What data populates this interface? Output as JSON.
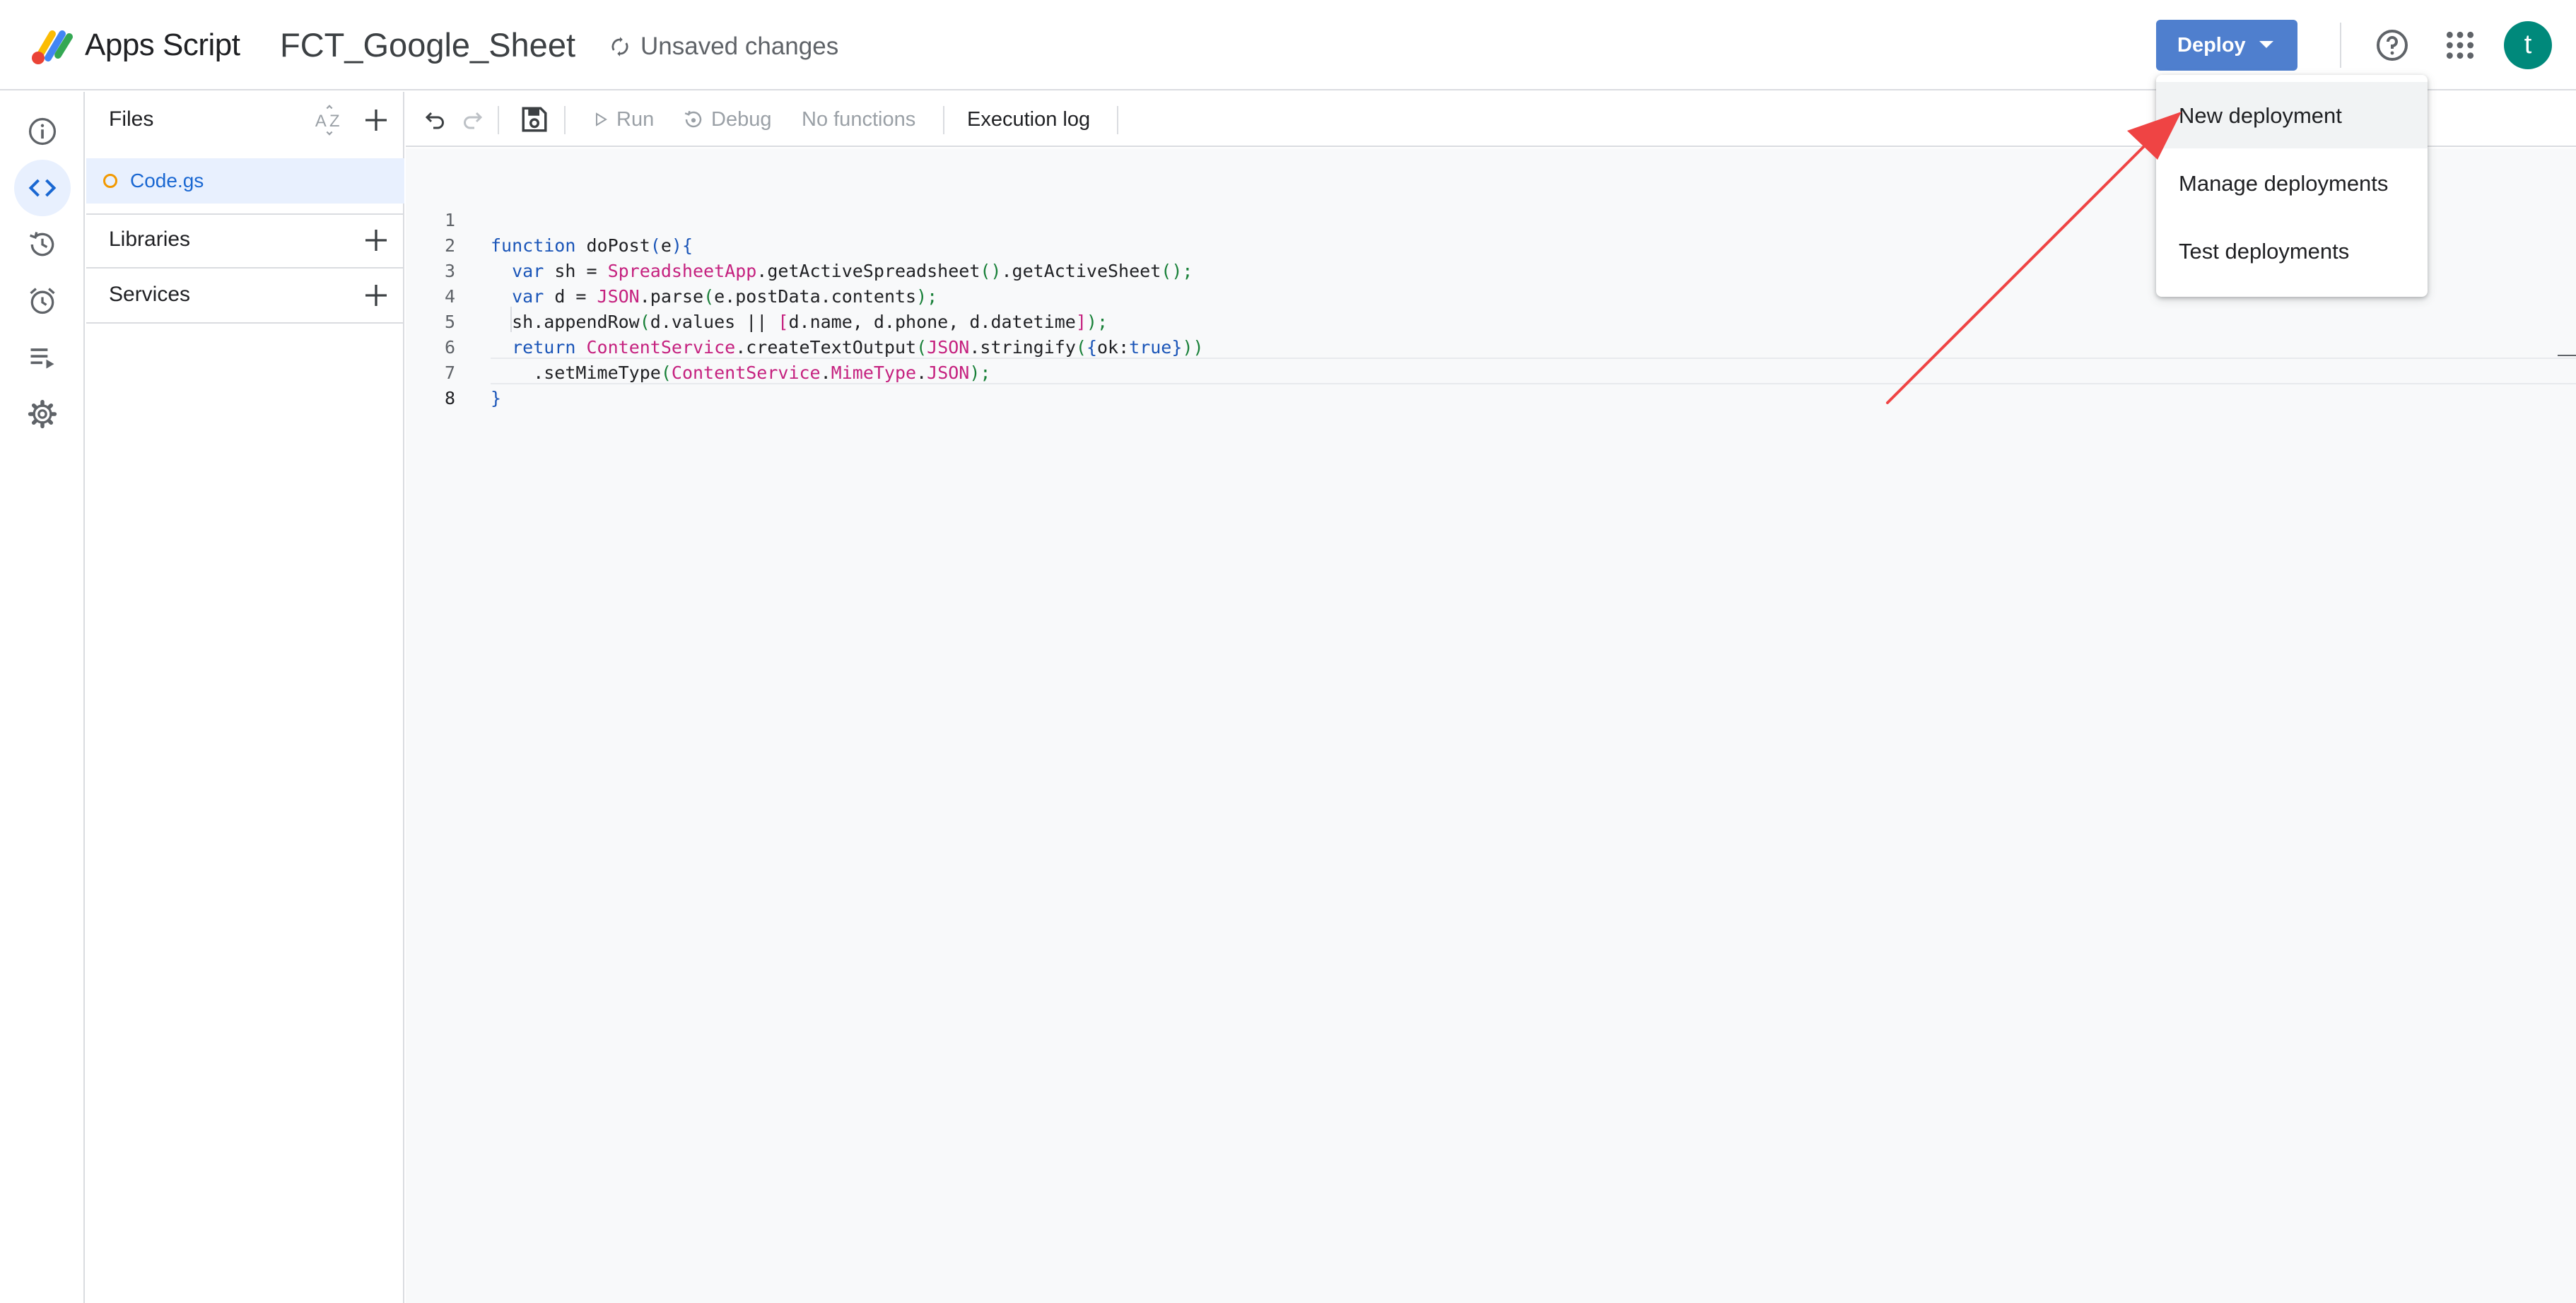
{
  "header": {
    "app_name": "Apps Script",
    "project_title": "FCT_Google_Sheet",
    "save_status": "Unsaved changes",
    "deploy_label": "Deploy",
    "avatar_initial": "t",
    "icons": [
      "apps-script-logo-icon",
      "sync-icon",
      "chevron-down-icon",
      "help-icon",
      "apps-grid-icon"
    ]
  },
  "rail": {
    "items": [
      {
        "name": "overview",
        "icon": "info-icon"
      },
      {
        "name": "editor",
        "icon": "code-icon",
        "active": true
      },
      {
        "name": "project-history",
        "icon": "history-icon"
      },
      {
        "name": "triggers",
        "icon": "alarm-clock-icon"
      },
      {
        "name": "executions",
        "icon": "executions-list-icon"
      },
      {
        "name": "project-settings",
        "icon": "gear-icon"
      }
    ]
  },
  "files_panel": {
    "title": "Files",
    "files": [
      {
        "name": "Code.gs",
        "unsaved": true
      }
    ],
    "libraries_label": "Libraries",
    "services_label": "Services"
  },
  "toolbar": {
    "run_label": "Run",
    "debug_label": "Debug",
    "function_select": "No functions",
    "execution_log_label": "Execution log"
  },
  "editor": {
    "lines": [
      "function doPost(e){",
      "  var sh = SpreadsheetApp.getActiveSpreadsheet().getActiveSheet();",
      "  var d = JSON.parse(e.postData.contents);",
      "  sh.appendRow(d.values || [d.name, d.phone, d.datetime]);",
      "  return ContentService.createTextOutput(JSON.stringify({ok:true}))",
      "    .setMimeType(ContentService.MimeType.JSON);",
      "}",
      ""
    ],
    "line_numbers": [
      "1",
      "2",
      "3",
      "4",
      "5",
      "6",
      "7",
      "8"
    ],
    "current_line": 8
  },
  "deploy_menu": {
    "items": [
      {
        "label": "New deployment",
        "highlighted": true
      },
      {
        "label": "Manage deployments"
      },
      {
        "label": "Test deployments"
      }
    ]
  },
  "annotation": {
    "type": "arrow",
    "color": "#ef4444",
    "points_to": "New deployment"
  },
  "colors": {
    "accent": "#4f7fce",
    "selected_bg": "#e8f0fe",
    "selected_text": "#1967d2",
    "avatar_bg": "#00897b",
    "unsaved_dot": "#f29900"
  }
}
